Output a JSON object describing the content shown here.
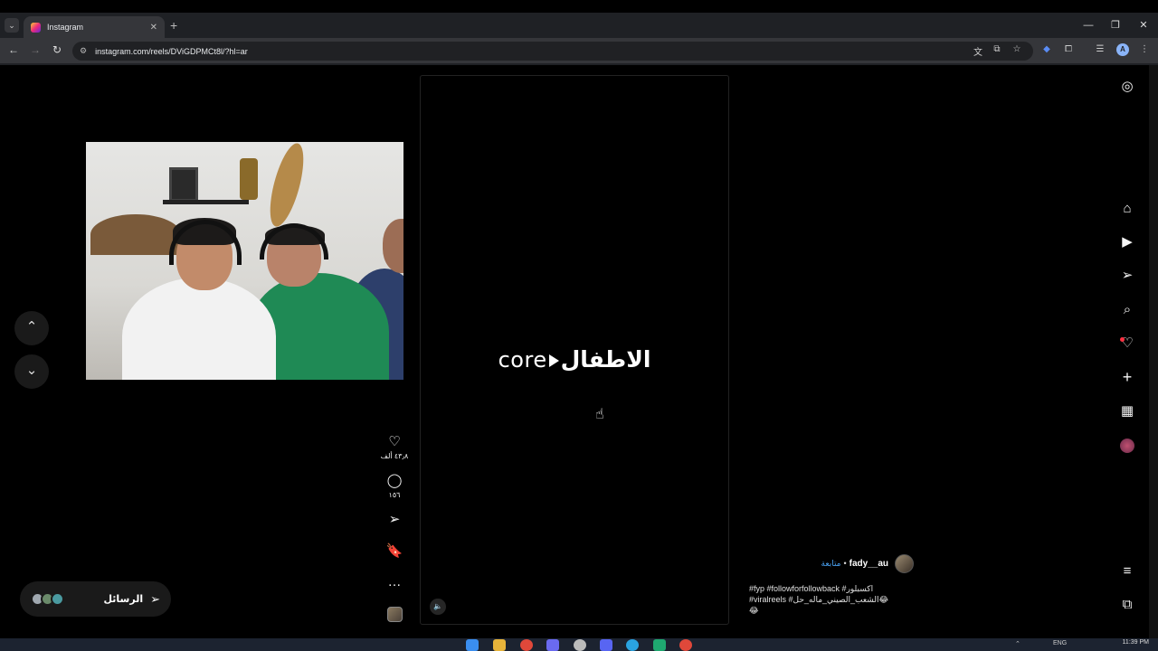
{
  "browser": {
    "tab_title": "Instagram",
    "tab_close": "✕",
    "new_tab": "+",
    "tab_list": "⌄",
    "url": "instagram.com/reels/DViGDPMCt8l/?hl=ar",
    "profile_initial": "A",
    "window_controls": [
      "—",
      "❐",
      "✕"
    ],
    "nav": {
      "back": "←",
      "forward": "→",
      "reload": "↻"
    },
    "site_info": "⚙"
  },
  "reel": {
    "overlay_arabic": "الاطفال",
    "overlay_latin": "core",
    "mute_icon": "🔈"
  },
  "actions": {
    "likes": "٤٣٫٨ ألف",
    "comments": "١٥٦",
    "like_icon": "♡",
    "comment_icon": "◯",
    "share_icon": "➢",
    "save_icon": "🔖",
    "more_icon": "…"
  },
  "navigation": {
    "up_icon": "⌃",
    "down_icon": "⌄"
  },
  "messages": {
    "label": "الرسائل",
    "icon": "➢",
    "avatar_colors": [
      "#a0a8b0",
      "#6a8a6a",
      "#4a9aa0"
    ]
  },
  "rail": {
    "instagram_icon": "◎",
    "home_icon": "⌂",
    "reels_icon": "▶",
    "share_icon": "➢",
    "search_icon": "⌕",
    "notifications_icon": "♡",
    "create_icon": "+",
    "dashboard_icon": "▦",
    "more_icon": "≡",
    "meta_icon": "⧉"
  },
  "author": {
    "name": "fady__au",
    "follow_label": "متابعة",
    "separator": "•"
  },
  "caption": {
    "line1": "#fyp #followforfollowback #اكسبلور",
    "line2": "#viralreels #الشعب_الصيني_ماله_حل😂",
    "line3": "😂"
  },
  "taskbar": {
    "time": "11:39 PM",
    "lang": "ENG"
  },
  "colors": {
    "background": "#000000",
    "accent_link": "#4aa3f5",
    "notif": "#ff3040"
  }
}
